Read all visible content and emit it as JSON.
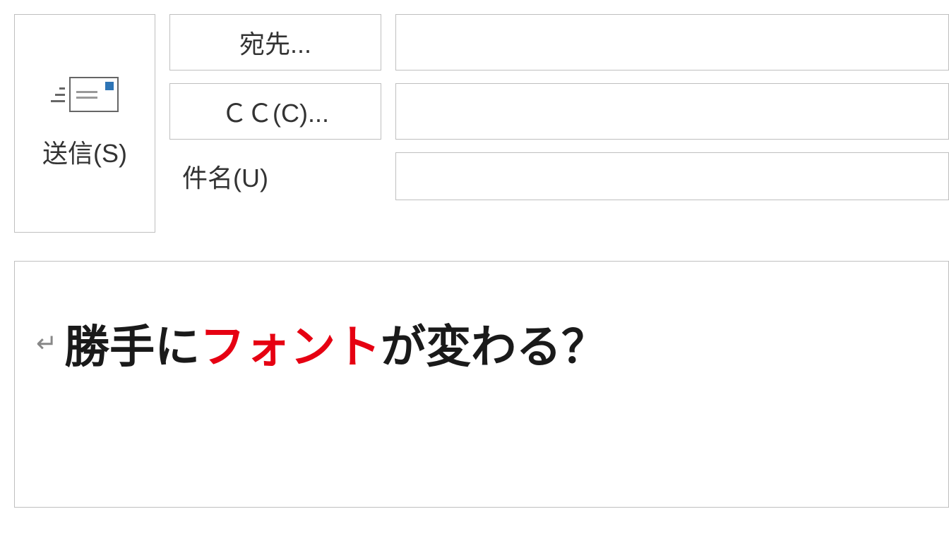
{
  "send": {
    "label": "送信(S)"
  },
  "fields": {
    "to_button": "宛先...",
    "cc_button": "ＣＣ(C)...",
    "subject_label": "件名(U)"
  },
  "body": {
    "return_mark": "↵",
    "part1": "勝手に",
    "part2_red": "フォント",
    "part3": "が変わる？"
  }
}
